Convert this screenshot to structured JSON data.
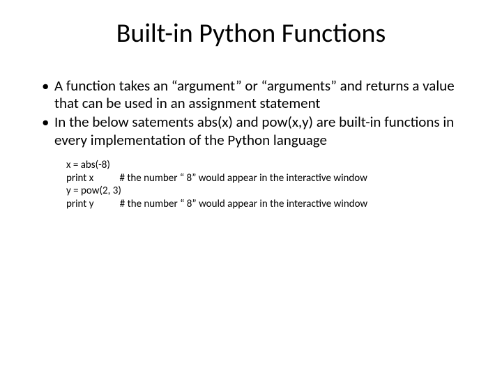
{
  "slide": {
    "title": "Built-in Python Functions",
    "bullets": [
      "A function takes an “argument” or “arguments” and returns a value that can be used in an assignment statement",
      "In the below satements abs(x) and pow(x,y) are built-in functions in every implementation of the Python language"
    ],
    "code": [
      "x = abs(-8)",
      "print x           # the number “ 8” would appear in the interactive window",
      "y = pow(2, 3)",
      "print y           # the number “ 8” would appear in the interactive window"
    ]
  }
}
